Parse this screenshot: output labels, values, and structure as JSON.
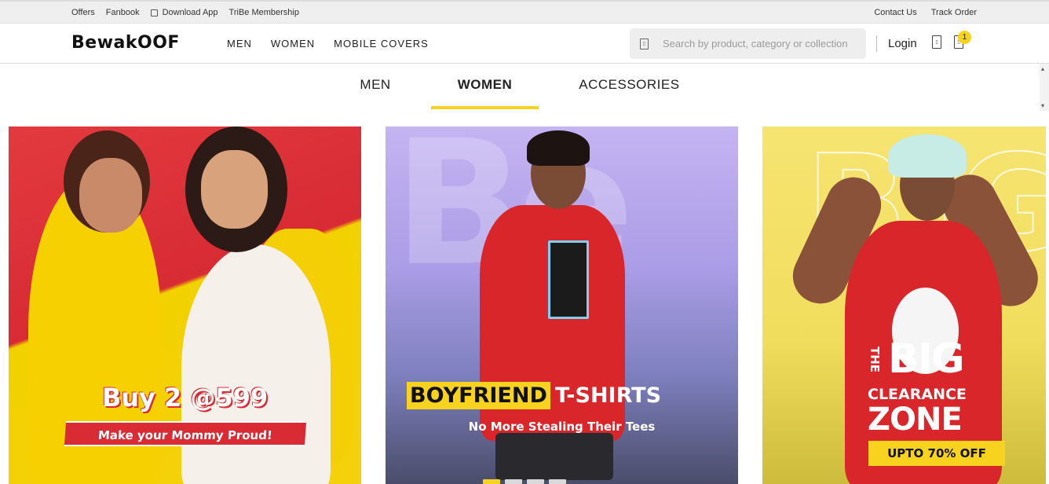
{
  "topbar": {
    "offers": "Offers",
    "fanbook": "Fanbook",
    "download_app": "Download App",
    "tribe": "TriBe Membership",
    "contact": "Contact Us",
    "track": "Track Order"
  },
  "header": {
    "logo": "BewakOOF",
    "nav": [
      "MEN",
      "WOMEN",
      "MOBILE COVERS"
    ],
    "search_placeholder": "Search by product, category or collection",
    "login": "Login",
    "cart_count": "1"
  },
  "category_tabs": {
    "items": [
      "MEN",
      "WOMEN",
      "ACCESSORIES"
    ],
    "active": "WOMEN"
  },
  "banners": [
    {
      "title": "Buy 2 @599",
      "ribbon": "Make your Mommy Proud!"
    },
    {
      "highlight": "BOYFRIEND",
      "title_rest": "T-SHIRTS",
      "subtitle": "No More Stealing Their Tees"
    },
    {
      "the": "THE",
      "big": "BIG",
      "clearance": "CLEARANCE",
      "zone": "ZONE",
      "offer": "UPTO 70% OFF"
    }
  ],
  "carousel": {
    "slides": 4,
    "active_index": 0
  },
  "colors": {
    "accent": "#f7d21e",
    "red": "#d82b34"
  }
}
